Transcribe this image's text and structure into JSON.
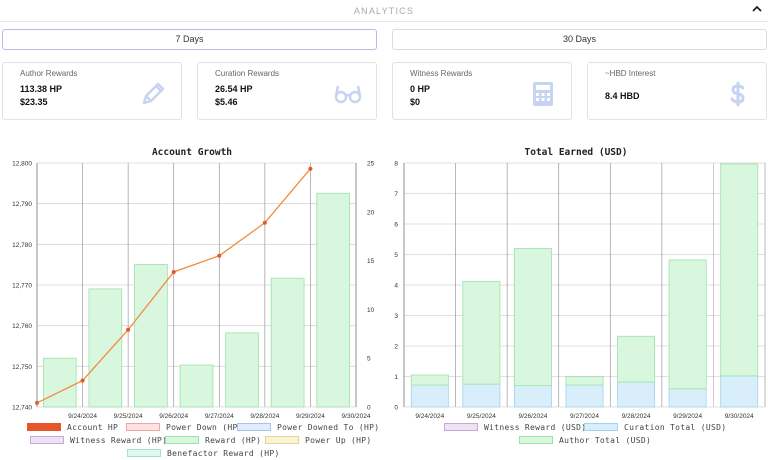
{
  "header": {
    "title": "ANALYTICS"
  },
  "range_buttons": {
    "days7": "7 Days",
    "days30": "30 Days"
  },
  "cards": [
    {
      "label": "Author Rewards",
      "v1": "113.38 HP",
      "v2": "$23.35",
      "icon": "pencil-icon"
    },
    {
      "label": "Curation Rewards",
      "v1": "26.54 HP",
      "v2": "$5.46",
      "icon": "glasses-icon"
    },
    {
      "label": "Witness Rewards",
      "v1": "0 HP",
      "v2": "$0",
      "icon": "calculator-icon"
    },
    {
      "label": "~HBD Interest",
      "v1": "8.4 HBD",
      "v2": "",
      "icon": "dollar-icon"
    }
  ],
  "chart_data": [
    {
      "type": "bar+line",
      "title": "Account Growth",
      "categories": [
        "9/24/2024",
        "9/25/2024",
        "9/26/2024",
        "9/27/2024",
        "9/28/2024",
        "9/29/2024",
        "9/30/2024"
      ],
      "y_left": {
        "ylim": [
          12740,
          12800
        ],
        "ticks": [
          "12,740",
          "12,750",
          "12,760",
          "12,770",
          "12,780",
          "12,790",
          "12,800"
        ]
      },
      "y_right": {
        "ylim": [
          0,
          25
        ],
        "ticks": [
          "0",
          "5",
          "10",
          "15",
          "20",
          "25"
        ]
      },
      "line_series": {
        "name": "Account HP",
        "axis": "left",
        "values": [
          12741,
          12746.5,
          12759,
          12773.2,
          12777.2,
          12785.3,
          12798.6
        ],
        "color": "#f08c3c"
      },
      "bar_series": {
        "name": "Reward (HP)",
        "axis": "right",
        "values": [
          5,
          12.1,
          14.6,
          4.3,
          7.6,
          13.2,
          21.9
        ],
        "fill": "#d9f7de",
        "stroke": "#9be3a6"
      },
      "legend": [
        {
          "label": "Account HP",
          "fill": "#e8572a",
          "stroke": "#e8572a"
        },
        {
          "label": "Power Down (HP)",
          "fill": "#fde2e2",
          "stroke": "#f0a5a5"
        },
        {
          "label": "Power Downed To (HP)",
          "fill": "#e3ecfd",
          "stroke": "#a9c3f0"
        },
        {
          "label": "Witness Reward (HP)",
          "fill": "#efe3f3",
          "stroke": "#c9a8d6"
        },
        {
          "label": "Reward (HP)",
          "fill": "#d9f7de",
          "stroke": "#9be3a6"
        },
        {
          "label": "Power Up (HP)",
          "fill": "#fbf3d7",
          "stroke": "#e6d492"
        },
        {
          "label": "Benefactor Reward (HP)",
          "fill": "#e1f7f1",
          "stroke": "#a6e0d0"
        }
      ],
      "grid": true
    },
    {
      "type": "stacked-bar",
      "title": "Total Earned (USD)",
      "categories": [
        "9/24/2024",
        "9/25/2024",
        "9/26/2024",
        "9/27/2024",
        "9/28/2024",
        "9/29/2024",
        "9/30/2024"
      ],
      "ylim": [
        0,
        8
      ],
      "ticks": [
        "0",
        "1",
        "2",
        "3",
        "4",
        "5",
        "6",
        "7",
        "8"
      ],
      "series": [
        {
          "name": "Witness Reward (USD)",
          "values": [
            0,
            0,
            0,
            0,
            0,
            0,
            0
          ],
          "fill": "#efe3f3",
          "stroke": "#c9a8d6"
        },
        {
          "name": "Curation Total (USD)",
          "values": [
            0.72,
            0.75,
            0.7,
            0.72,
            0.82,
            0.6,
            1.02
          ],
          "fill": "#d8eefb",
          "stroke": "#a3d2f0"
        },
        {
          "name": "Author Total (USD)",
          "values": [
            0.33,
            3.37,
            4.5,
            0.28,
            1.5,
            4.22,
            6.95
          ],
          "fill": "#d9f7de",
          "stroke": "#9be3a6"
        }
      ],
      "legend": [
        {
          "label": "Witness Reward (USD)",
          "fill": "#efe3f3",
          "stroke": "#c9a8d6"
        },
        {
          "label": "Curation Total (USD)",
          "fill": "#d8eefb",
          "stroke": "#a3d2f0"
        },
        {
          "label": "Author Total (USD)",
          "fill": "#d9f7de",
          "stroke": "#9be3a6"
        }
      ],
      "grid": true
    }
  ]
}
